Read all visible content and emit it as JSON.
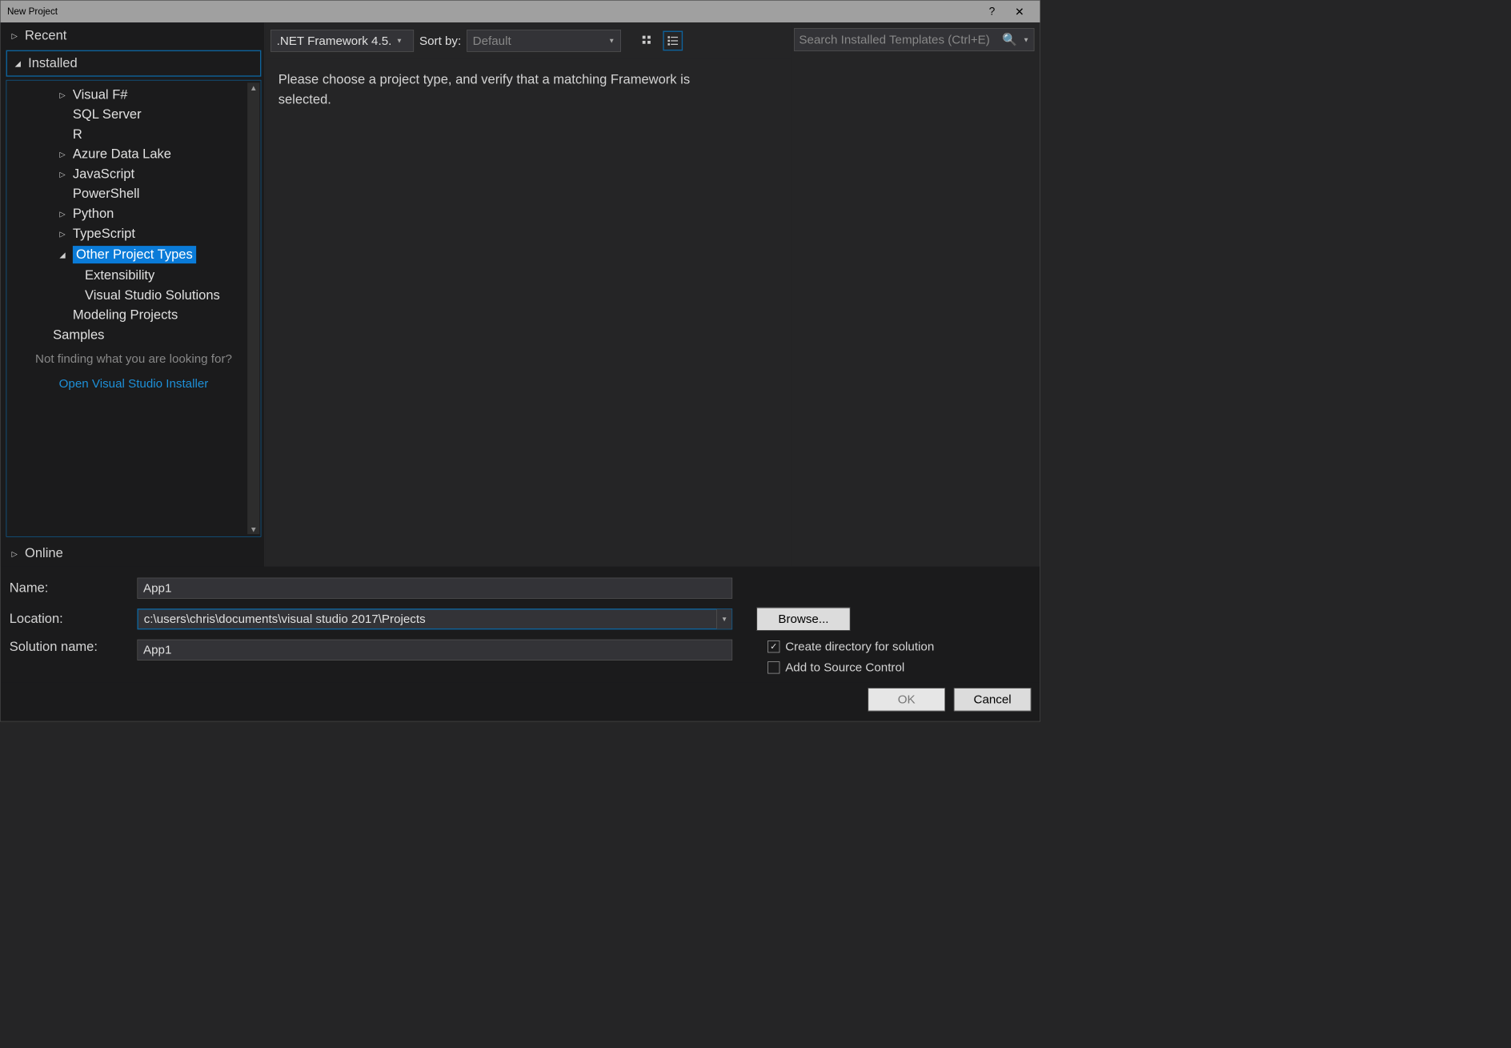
{
  "titlebar": {
    "title": "New Project",
    "help": "?",
    "close": "✕"
  },
  "tree": {
    "recent": "Recent",
    "installed": "Installed",
    "items": [
      {
        "label": "Visual F#",
        "arrow": "▷",
        "indent": 2
      },
      {
        "label": "SQL Server",
        "arrow": "",
        "indent": 2
      },
      {
        "label": "R",
        "arrow": "",
        "indent": 2
      },
      {
        "label": "Azure Data Lake",
        "arrow": "▷",
        "indent": 2
      },
      {
        "label": "JavaScript",
        "arrow": "▷",
        "indent": 2
      },
      {
        "label": "PowerShell",
        "arrow": "",
        "indent": 2
      },
      {
        "label": "Python",
        "arrow": "▷",
        "indent": 2
      },
      {
        "label": "TypeScript",
        "arrow": "▷",
        "indent": 2
      },
      {
        "label": "Other Project Types",
        "arrow": "◢",
        "indent": 2,
        "selected": true
      },
      {
        "label": "Extensibility",
        "arrow": "",
        "indent": 3
      },
      {
        "label": "Visual Studio Solutions",
        "arrow": "",
        "indent": 3
      },
      {
        "label": "Modeling Projects",
        "arrow": "",
        "indent": 2
      },
      {
        "label": "Samples",
        "arrow": "",
        "indent": 1
      }
    ],
    "hint": "Not finding what you are looking for?",
    "link": "Open Visual Studio Installer",
    "online": "Online"
  },
  "toolbar": {
    "framework": ".NET Framework 4.5.",
    "sortby_label": "Sort by:",
    "sort_value": "Default"
  },
  "content": {
    "message": "Please choose a project type, and verify that a matching Framework is selected."
  },
  "search": {
    "placeholder": "Search Installed Templates (Ctrl+E)"
  },
  "form": {
    "name_label": "Name:",
    "name_value": "App1",
    "location_label": "Location:",
    "location_value": "c:\\users\\chris\\documents\\visual studio 2017\\Projects",
    "solution_label": "Solution name:",
    "solution_value": "App1",
    "browse": "Browse...",
    "chk_createdir": "Create directory for solution",
    "chk_source": "Add to Source Control"
  },
  "buttons": {
    "ok": "OK",
    "cancel": "Cancel"
  }
}
